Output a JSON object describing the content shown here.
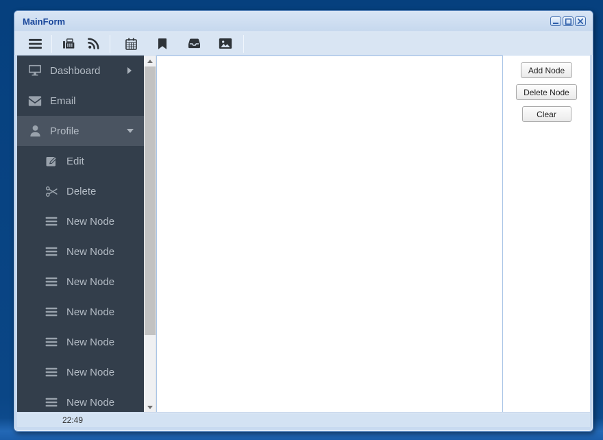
{
  "window": {
    "title": "MainForm",
    "controls": [
      {
        "name": "minimize"
      },
      {
        "name": "maximize"
      },
      {
        "name": "close"
      }
    ]
  },
  "toolbar": {
    "icons": [
      "menu-icon",
      "fax-icon",
      "rss-icon",
      "calendar-icon",
      "bookmark-icon",
      "inbox-icon",
      "image-icon"
    ],
    "groups": [
      [
        "menu-icon"
      ],
      [
        "fax-icon",
        "rss-icon"
      ],
      [
        "calendar-icon",
        "bookmark-icon",
        "inbox-icon",
        "image-icon"
      ]
    ]
  },
  "sidebar": {
    "items": [
      {
        "label": "Dashboard",
        "icon": "monitor-icon",
        "level": 0,
        "caret": "right",
        "selected": false
      },
      {
        "label": "Email",
        "icon": "envelope-icon",
        "level": 0,
        "caret": null,
        "selected": false
      },
      {
        "label": "Profile",
        "icon": "user-icon",
        "level": 0,
        "caret": "down",
        "selected": true
      },
      {
        "label": "Edit",
        "icon": "edit-icon",
        "level": 1
      },
      {
        "label": "Delete",
        "icon": "scissors-icon",
        "level": 1
      },
      {
        "label": "New Node",
        "icon": "bars-icon",
        "level": 1
      },
      {
        "label": "New Node",
        "icon": "bars-icon",
        "level": 1
      },
      {
        "label": "New Node",
        "icon": "bars-icon",
        "level": 1
      },
      {
        "label": "New Node",
        "icon": "bars-icon",
        "level": 1
      },
      {
        "label": "New Node",
        "icon": "bars-icon",
        "level": 1
      },
      {
        "label": "New Node",
        "icon": "bars-icon",
        "level": 1
      },
      {
        "label": "New Node",
        "icon": "bars-icon",
        "level": 1
      }
    ]
  },
  "panel": {
    "buttons": [
      {
        "label": "Add Node"
      },
      {
        "label": "Delete Node"
      },
      {
        "label": "Clear"
      }
    ]
  },
  "statusbar": {
    "time": "22:49"
  },
  "colors": {
    "desktop": "#06407e",
    "frame": "#c8daf0",
    "title_text": "#17459a",
    "toolbar_bg": "#d9e5f3",
    "toolbar_icon": "#2e3338",
    "sidebar_bg": "#333e4b",
    "sidebar_selected_bg": "#4a5461",
    "sidebar_text": "#b4bcc5",
    "content_border": "#a9c4e6",
    "scroll_thumb": "#c2c2c2",
    "button_border": "#a9a9a9",
    "status_bg": "#d3e2f3"
  }
}
